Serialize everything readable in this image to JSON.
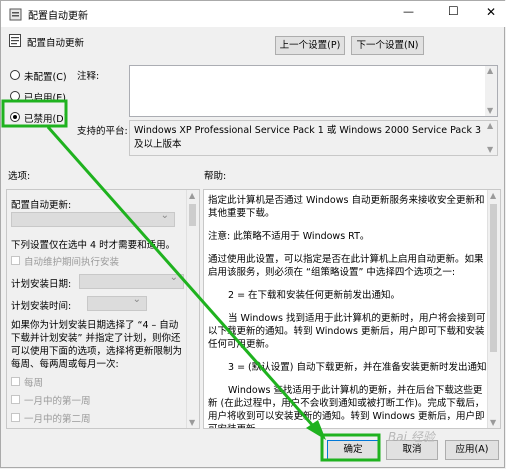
{
  "window": {
    "title": "配置自动更新",
    "min": "—",
    "max": "☐",
    "close": "✕"
  },
  "header": {
    "policy_name": "配置自动更新",
    "prev_button": "上一个设置(P)",
    "next_button": "下一个设置(N)"
  },
  "state": {
    "options": [
      {
        "label": "未配置(C)",
        "selected": false
      },
      {
        "label": "已启用(E)",
        "selected": false
      },
      {
        "label": "已禁用(D)",
        "selected": true
      }
    ]
  },
  "comment": {
    "label": "注释:",
    "value": ""
  },
  "supported": {
    "label": "支持的平台:",
    "value": "Windows XP Professional Service Pack 1 或 Windows 2000 Service Pack 3 及以上版本"
  },
  "options_panel": {
    "label": "选项:",
    "configure_label": "配置自动更新:",
    "line_install_4am": "下列设置仅在选中 4 时才需要和适用。",
    "auto_maintenance": "自动维护期间执行安装",
    "scheduled_day_label": "计划安装日期:",
    "scheduled_time_label": "计划安装时间:",
    "note": "如果你为计划安装日期选择了 “4 – 自动下载并计划安装” 并指定了计划，则你还可以使用下面的选项，选择将更新限制为每周、每两周或每月一次:",
    "weekly": "每周",
    "first_week": "一月中的第一周",
    "second_week": "一月中的第二周"
  },
  "help_panel": {
    "label": "帮助:",
    "paragraphs": [
      "指定此计算机是否通过 Windows 自动更新服务来接收安全更新和其他重要下载。",
      "注意: 此策略不适用于 Windows RT。",
      "通过使用此设置，可以指定是否在此计算机上启用自动更新。如果启用该服务，则必须在 “组策略设置” 中选择四个选项之一:",
      "2 = 在下载和安装任何更新前发出通知。",
      "当 Windows 找到适用于此计算机的更新时，用户将会接到可以下载更新的通知。转到 Windows 更新后，用户即可下载和安装任何可用更新。",
      "3 = (默认设置) 自动下载更新，并在准备安装更新时发出通知",
      "Windows 查找适用于此计算机的更新，并在后台下载这些更新 (在此过程中，用户不会收到通知或被打断工作)。完成下载后，用户将收到可以安装更新的通知。转到 Windows 更新后，用户即可安装更新。"
    ]
  },
  "footer": {
    "ok": "确定",
    "cancel": "取消",
    "apply": "应用(A)"
  },
  "annotation": {
    "color": "#1fb21f",
    "watermark": "Bai 经验"
  }
}
